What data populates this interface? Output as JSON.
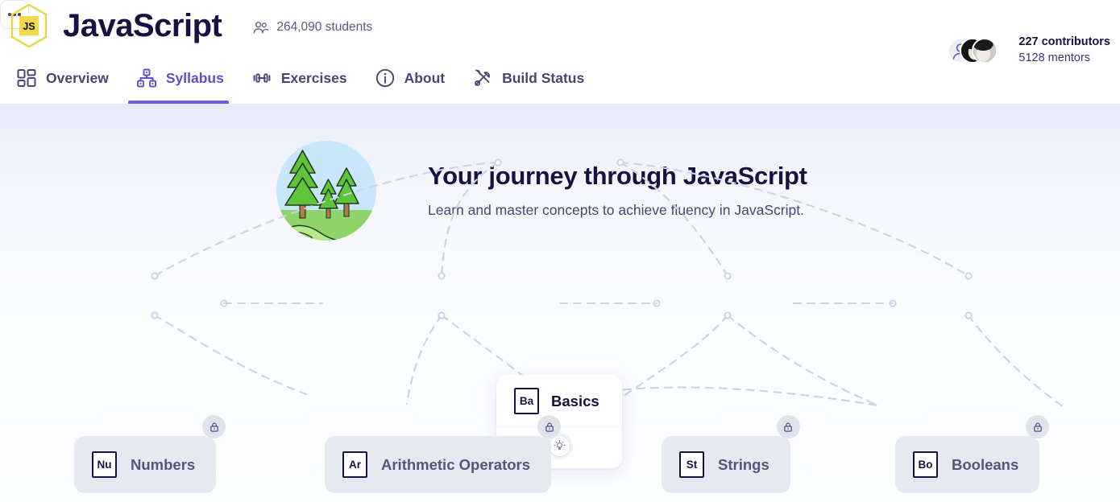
{
  "header": {
    "logo_icon": "javascript-hexagon-logo",
    "logo_text": "JS",
    "track_title": "JavaScript",
    "students_icon": "people-icon",
    "students_count": "264,090 students",
    "contributors": "227 contributors",
    "mentors": "5128 mentors",
    "more_button_icon": "ellipsis-icon",
    "tabs": [
      {
        "label": "Overview",
        "icon": "dashboard-grid-icon",
        "active": false
      },
      {
        "label": "Syllabus",
        "icon": "hierarchy-tree-icon",
        "active": true
      },
      {
        "label": "Exercises",
        "icon": "dumbbell-icon",
        "active": false
      },
      {
        "label": "About",
        "icon": "info-circle-icon",
        "active": false
      },
      {
        "label": "Build Status",
        "icon": "tools-icon",
        "active": false
      }
    ]
  },
  "hero": {
    "illustration": "forest-landscape-circle",
    "title": "Your journey through JavaScript",
    "subtitle": "Learn and master concepts to achieve fluency in JavaScript."
  },
  "syllabus": {
    "root": {
      "abbr": "Ba",
      "title": "Basics",
      "action_icon": "lightbulb-icon",
      "locked": false
    },
    "concepts": [
      {
        "abbr": "Nu",
        "title": "Numbers",
        "locked": true,
        "lock_icon": "lock-icon"
      },
      {
        "abbr": "Ar",
        "title": "Arithmetic Operators",
        "locked": true,
        "lock_icon": "lock-icon"
      },
      {
        "abbr": "St",
        "title": "Strings",
        "locked": true,
        "lock_icon": "lock-icon"
      },
      {
        "abbr": "Bo",
        "title": "Booleans",
        "locked": true,
        "lock_icon": "lock-icon"
      }
    ]
  },
  "colors": {
    "accent": "#6b5ce7",
    "heading": "#1a1042",
    "muted": "#4a4572",
    "locked_card": "#e7e9f0",
    "edge": "#ccd3e8",
    "logo_yellow": "#f0db4f"
  }
}
